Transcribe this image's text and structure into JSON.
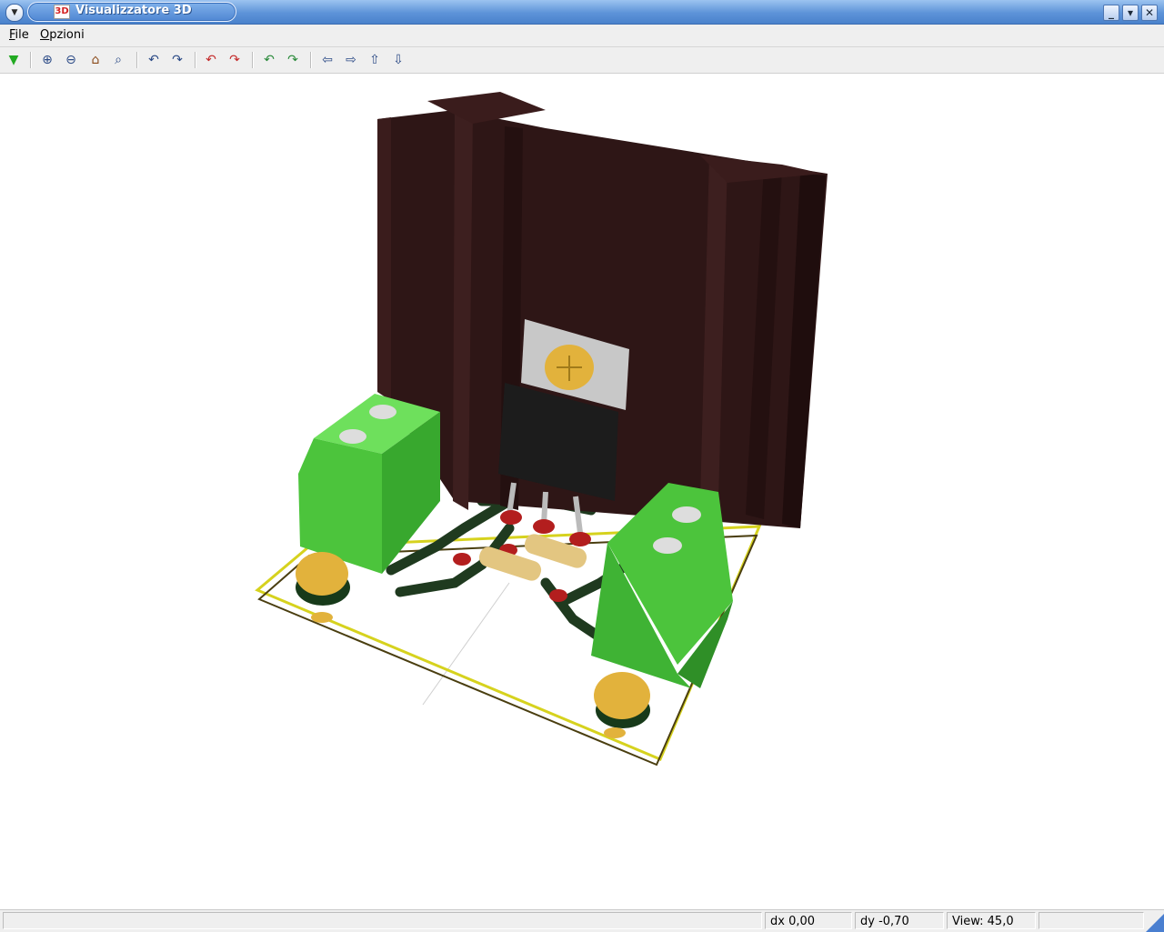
{
  "window": {
    "title": "Visualizzatore 3D",
    "app_icon_text": "3D"
  },
  "menubar": {
    "items": [
      "File",
      "Opzioni"
    ]
  },
  "toolbar": {
    "buttons": [
      {
        "name": "reload-button",
        "glyph": "▼",
        "color": "#22aa22"
      },
      {
        "name": "zoom-in-button",
        "glyph": "⊕"
      },
      {
        "name": "zoom-out-button",
        "glyph": "⊖"
      },
      {
        "name": "redraw-button",
        "glyph": "⌂"
      },
      {
        "name": "zoom-fit-button",
        "glyph": "⌕"
      },
      {
        "name": "rotate-x-neg-button",
        "glyph": "↶"
      },
      {
        "name": "rotate-x-pos-button",
        "glyph": "↷"
      },
      {
        "name": "rotate-y-neg-button",
        "glyph": "↶"
      },
      {
        "name": "rotate-y-pos-button",
        "glyph": "↷"
      },
      {
        "name": "rotate-z-neg-button",
        "glyph": "↶"
      },
      {
        "name": "rotate-z-pos-button",
        "glyph": "↷"
      },
      {
        "name": "move-left-button",
        "glyph": "⇦"
      },
      {
        "name": "move-right-button",
        "glyph": "⇨"
      },
      {
        "name": "move-up-button",
        "glyph": "⇧"
      },
      {
        "name": "move-down-button",
        "glyph": "⇩"
      }
    ]
  },
  "status": {
    "dx": "dx 0,00",
    "dy": "dy -0,70",
    "view": "View: 45,0"
  },
  "colors": {
    "heatsink": "#2e1616",
    "terminal": "#4cc43c",
    "board_outline": "#d6d21e",
    "trace": "#1f3a1f",
    "transistor": "#1c1c1c",
    "screw": "#e2b23c"
  }
}
